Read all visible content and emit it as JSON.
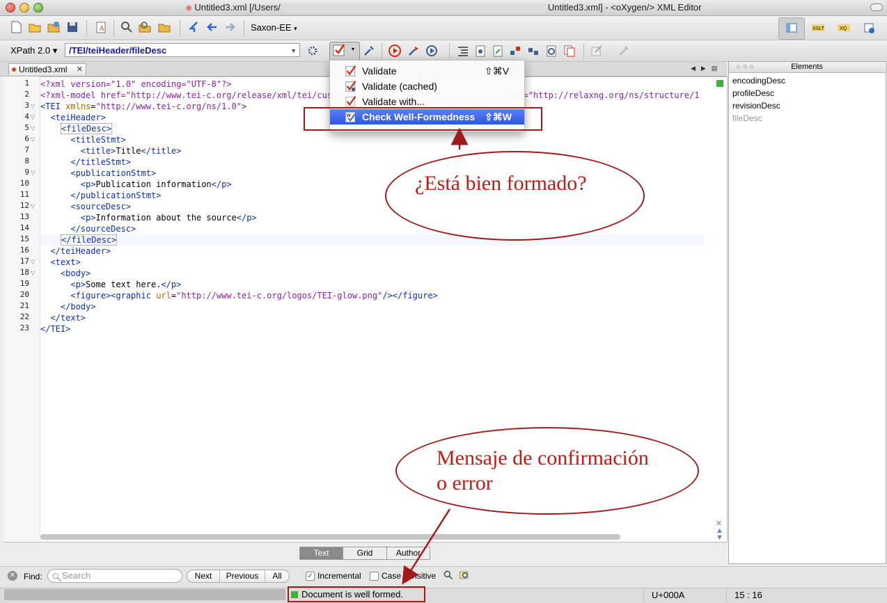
{
  "window": {
    "title_left": "Untitled3.xml [/Users/",
    "title_right": "Untitled3.xml] - <oXygen/> XML Editor"
  },
  "toolbar": {
    "transformer": "Saxon-EE",
    "xpath_label": "XPath 2.0 ▾",
    "xpath_value": "/TEI/teiHeader/fileDesc"
  },
  "editor": {
    "tab_label": "Untitled3.xml",
    "line_numbers": [
      "1",
      "2",
      "3",
      "4",
      "5",
      "6",
      "7",
      "8",
      "9",
      "10",
      "11",
      "12",
      "13",
      "14",
      "15",
      "16",
      "17",
      "18",
      "19",
      "20",
      "21",
      "22",
      "23"
    ],
    "mode_tabs": [
      "Text",
      "Grid",
      "Author"
    ],
    "active_mode": "Text"
  },
  "validate_menu": {
    "items": [
      {
        "label": "Validate",
        "shortcut": "⇧⌘V"
      },
      {
        "label": "Validate (cached)",
        "shortcut": ""
      },
      {
        "label": "Validate with...",
        "shortcut": ""
      },
      {
        "label": "Check Well-Formedness",
        "shortcut": "⇧⌘W"
      }
    ],
    "highlighted_index": 3
  },
  "elements_panel": {
    "title": "Elements",
    "items": [
      "encodingDesc",
      "profileDesc",
      "revisionDesc",
      "fileDesc"
    ]
  },
  "find_bar": {
    "label": "Find:",
    "placeholder": "Search",
    "buttons": [
      "Next",
      "Previous",
      "All"
    ],
    "incremental_label": "Incremental",
    "incremental_checked": true,
    "case_label": "Case sensitive",
    "case_checked": false
  },
  "status": {
    "message": "Document is well formed.",
    "unicode": "U+000A",
    "position": "15 : 16"
  },
  "annotations": {
    "question": "¿Está bien formado?",
    "message_line1": "Mensaje de confirmación",
    "message_line2": "o error"
  },
  "colors": {
    "annotation_red": "#a21919",
    "menu_highlight": "#3a63ee",
    "status_ok": "#3bb33b"
  }
}
